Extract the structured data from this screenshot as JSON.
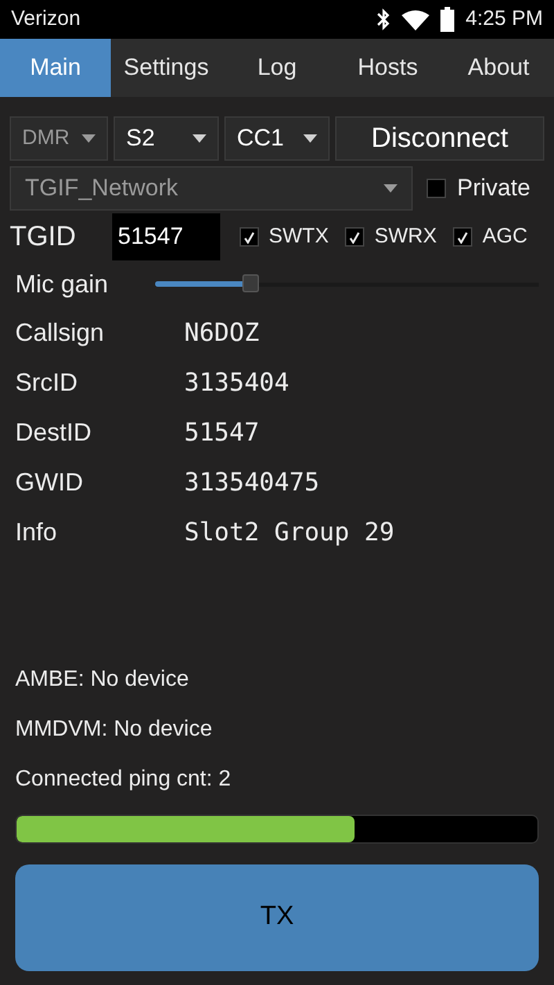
{
  "status_bar": {
    "carrier": "Verizon",
    "time": "4:25 PM"
  },
  "tabs": [
    {
      "label": "Main",
      "selected": true
    },
    {
      "label": "Settings",
      "selected": false
    },
    {
      "label": "Log",
      "selected": false
    },
    {
      "label": "Hosts",
      "selected": false
    },
    {
      "label": "About",
      "selected": false
    }
  ],
  "selectors": [
    {
      "value": "DMR",
      "disabled": true
    },
    {
      "value": "S2",
      "disabled": false
    },
    {
      "value": "CC1",
      "disabled": false
    }
  ],
  "connect_button": "Disconnect",
  "network": {
    "value": "TGIF_Network",
    "disabled": true
  },
  "private": {
    "label": "Private",
    "checked": false
  },
  "tgid": {
    "label": "TGID",
    "value": "51547"
  },
  "options": [
    {
      "label": "SWTX",
      "checked": true
    },
    {
      "label": "SWRX",
      "checked": true
    },
    {
      "label": "AGC",
      "checked": true
    }
  ],
  "mic_gain": {
    "label": "Mic gain",
    "level": 0.25
  },
  "info": [
    {
      "label": "Callsign",
      "value": "N6DOZ"
    },
    {
      "label": "SrcID",
      "value": "3135404"
    },
    {
      "label": "DestID",
      "value": "51547"
    },
    {
      "label": "GWID",
      "value": "313540475"
    },
    {
      "label": "Info",
      "value": "Slot2 Group 29"
    }
  ],
  "status_lines": [
    "AMBE: No device",
    "MMDVM: No device",
    "Connected ping cnt: 2"
  ],
  "ping_progress": {
    "level": 0.65
  },
  "tx_button": "TX"
}
